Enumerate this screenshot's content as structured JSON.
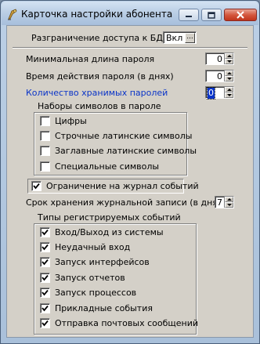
{
  "window": {
    "title": "Карточка настройки абонента \"Г...",
    "app_icon": "app-icon",
    "minimize_icon": "minimize-icon",
    "maximize_icon": "maximize-icon",
    "close_icon": "close-icon"
  },
  "access": {
    "label": "Разграничение доступа к БД",
    "value": "Вкл",
    "picker_label": "..."
  },
  "password": {
    "min_length_label": "Минимальная длина пароля",
    "min_length_value": "0",
    "validity_label": "Время действия пароля (в днях)",
    "validity_value": "0",
    "history_label": "Количество хранимых паролей",
    "history_value": "0"
  },
  "charsets": {
    "title": "Наборы символов в пароле",
    "items": [
      {
        "label": "Цифры",
        "checked": false
      },
      {
        "label": "Строчные латинские символы",
        "checked": false
      },
      {
        "label": "Заглавные латинские символы",
        "checked": false
      },
      {
        "label": "Специальные символы",
        "checked": false
      }
    ]
  },
  "journal": {
    "limit_label": "Ограничение на журнал событий",
    "limit_checked": true,
    "retention_label": "Срок хранения журнальной записи (в днях)",
    "retention_value": "7"
  },
  "events": {
    "title": "Типы регистрируемых событий",
    "items": [
      {
        "label": "Вход/Выход из системы",
        "checked": true
      },
      {
        "label": "Неудачный вход",
        "checked": true
      },
      {
        "label": "Запуск интерфейсов",
        "checked": true
      },
      {
        "label": "Запуск отчетов",
        "checked": true
      },
      {
        "label": "Запуск процессов",
        "checked": true
      },
      {
        "label": "Прикладные события",
        "checked": true
      },
      {
        "label": "Отправка почтовых сообщений",
        "checked": true
      }
    ]
  },
  "colors": {
    "highlight_label": "#0a34c8",
    "dialog_bg": "#d4d0c8",
    "title_gradient_top": "#d3e2f2",
    "close_button": "#c0351c"
  }
}
